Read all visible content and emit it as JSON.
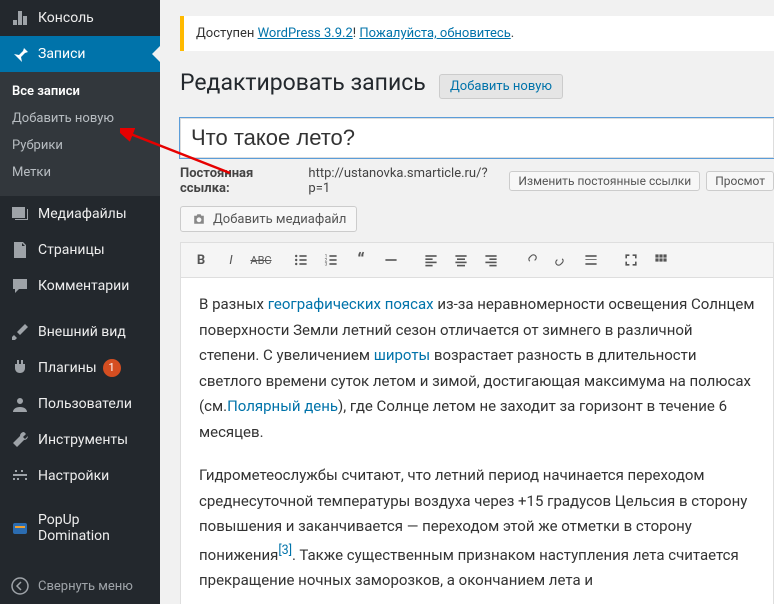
{
  "sidebar": {
    "dashboard": "Консоль",
    "posts": "Записи",
    "posts_sub": {
      "all": "Все записи",
      "add": "Добавить новую",
      "categories": "Рубрики",
      "tags": "Метки"
    },
    "media": "Медиафайлы",
    "pages": "Страницы",
    "comments": "Комментарии",
    "appearance": "Внешний вид",
    "plugins": "Плагины",
    "plugins_badge": "1",
    "users": "Пользователи",
    "tools": "Инструменты",
    "settings": "Настройки",
    "popup": "PopUp Domination",
    "collapse": "Свернуть меню"
  },
  "notice": {
    "prefix": "Доступен ",
    "version_link": "WordPress 3.9.2",
    "mid": "! ",
    "update_link": "Пожалуйста, обновитесь",
    "suffix": "."
  },
  "page_title": "Редактировать запись",
  "add_new_label": "Добавить новую",
  "post_title": "Что такое лето?",
  "permalink": {
    "label": "Постоянная ссылка:",
    "url": "http://ustanovka.smarticle.ru/?p=1",
    "edit_btn": "Изменить постоянные ссылки",
    "view_btn": "Просмот"
  },
  "media_btn": "Добавить медиафайл",
  "editor": {
    "p1_a": "В разных ",
    "p1_link1": "географических поясах",
    "p1_b": " из-за неравномерности освещения Солнцем поверхности Земли летний сезон отличается от зимнего в различной степени. С увеличением ",
    "p1_link2": "широты",
    "p1_c": " возрастает разность в длительности светлого времени суток летом и зимой, достигающая максимума на полюсах (см.",
    "p1_link3": "Полярный день",
    "p1_d": "), где Солнце летом не заходит за горизонт в течение 6 месяцев.",
    "p2_a": "Гидрометеослужбы считают, что летний период начинается переходом среднесуточной температуры воздуха через +15 градусов Цельсия в сторону повышения и заканчивается — переходом этой же отметки в сторону понижения",
    "p2_sup": "[3]",
    "p2_b": ". Также существенным признаком наступления лета считается прекращение ночных заморозков, а окончанием лета и"
  }
}
